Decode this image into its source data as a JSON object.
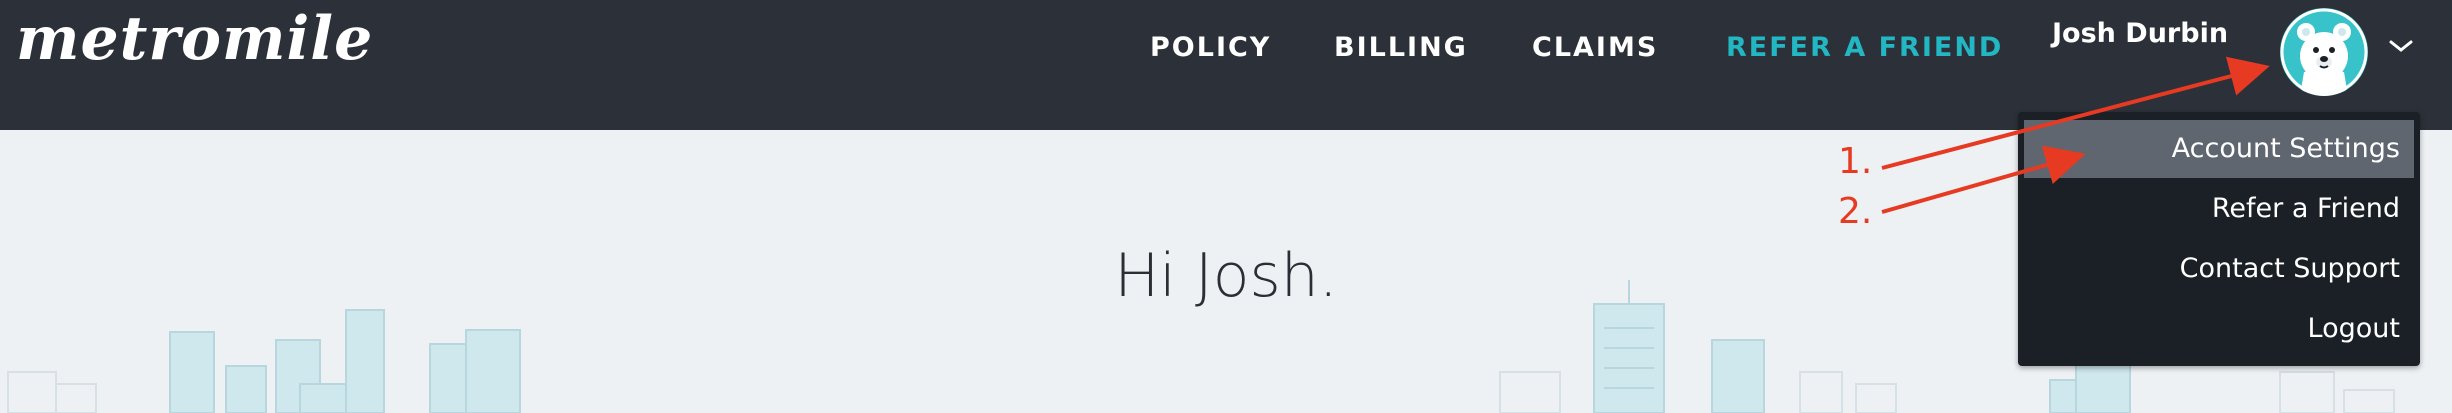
{
  "brand": {
    "logo_text": "metromile"
  },
  "nav": {
    "items": [
      {
        "label": "POLICY"
      },
      {
        "label": "BILLING"
      },
      {
        "label": "CLAIMS"
      },
      {
        "label": "REFER A FRIEND"
      }
    ]
  },
  "user": {
    "name": "Josh Durbin"
  },
  "dropdown": {
    "items": [
      {
        "label": "Account Settings",
        "highlighted": true
      },
      {
        "label": "Refer a Friend"
      },
      {
        "label": "Contact Support"
      },
      {
        "label": "Logout"
      }
    ]
  },
  "main": {
    "greeting": "Hi Josh."
  },
  "annotations": {
    "step1": "1.",
    "step2": "2."
  },
  "colors": {
    "topbar": "#2c3139",
    "accent": "#22b7c2",
    "menu": "#1b1f26",
    "menu_highlight": "#5f6670",
    "annotation": "#e63a22",
    "background": "#eef1f4"
  }
}
